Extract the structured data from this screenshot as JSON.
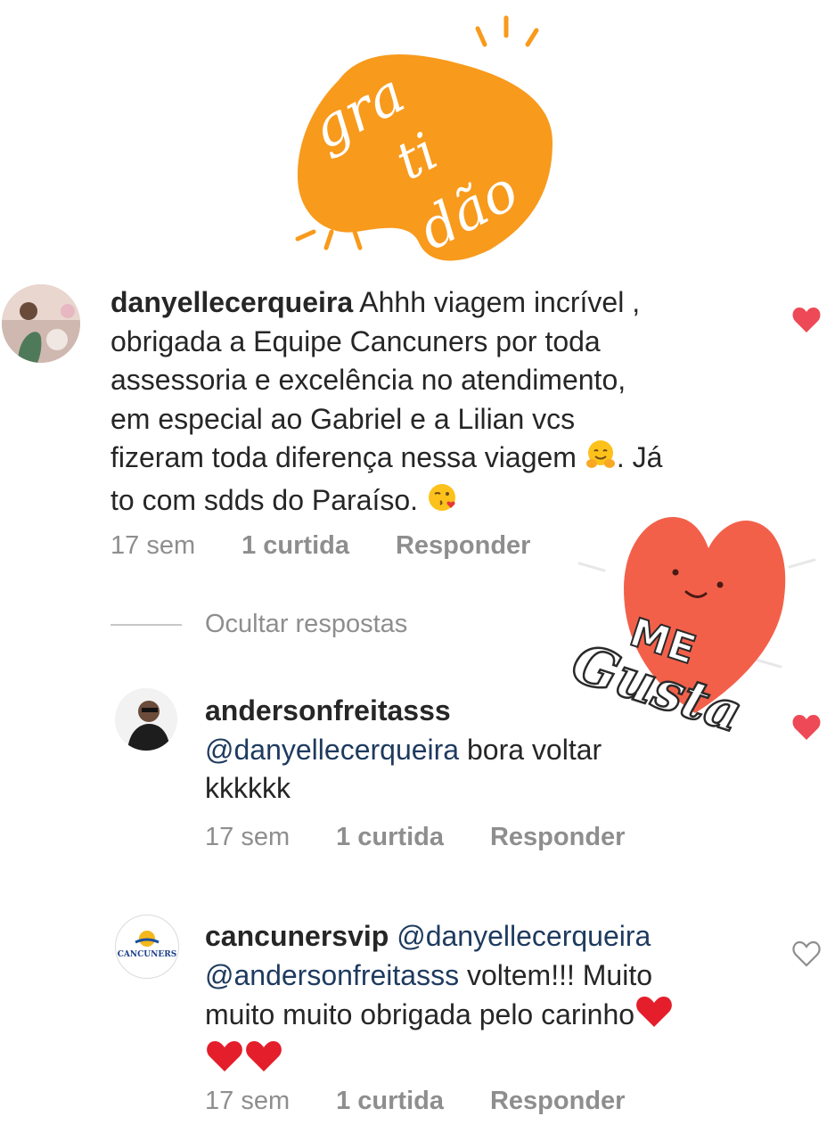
{
  "sticker_top": {
    "text_lines": [
      "gra",
      "ti",
      "dão"
    ],
    "color": "#f89a1c"
  },
  "sticker_heart": {
    "line1": "ME",
    "line2": "Gusta",
    "color": "#f3604a"
  },
  "comments": [
    {
      "username": "danyellecerqueira",
      "text_lines": [
        "Ahhh viagem incrível ,",
        "obrigada a Equipe Cancuners por toda",
        "assessoria e excelência no atendimento,",
        "em especial ao Gabriel e a Lilian vcs",
        "fizeram toda diferença nessa viagem",
        ". Já",
        "to com sdds do Paraíso."
      ],
      "emoji1": "hugging-face-emoji",
      "emoji2": "face-blowing-kiss-emoji",
      "time": "17 sem",
      "likes": "1 curtida",
      "reply": "Responder",
      "liked": true
    },
    {
      "username": "andersonfreitasss",
      "mention": "@danyellecerqueira",
      "text_lines": [
        "bora voltar",
        "kkkkkk"
      ],
      "time": "17 sem",
      "likes": "1 curtida",
      "reply": "Responder",
      "liked": true
    },
    {
      "username": "cancunersvip",
      "mention1": "@danyellecerqueira",
      "mention2": "@andersonfreitasss",
      "text_lines": [
        "voltem!!! Muito",
        "muito muito obrigada pelo carinho"
      ],
      "avatar_logo": "CANCUNERS",
      "time": "17 sem",
      "likes": "1 curtida",
      "reply": "Responder",
      "liked": false
    }
  ],
  "hide_replies": "Ocultar respostas",
  "colors": {
    "like_red": "#ed4956",
    "meta_gray": "#8e8e8e",
    "mention_blue": "#1e3a5f"
  }
}
